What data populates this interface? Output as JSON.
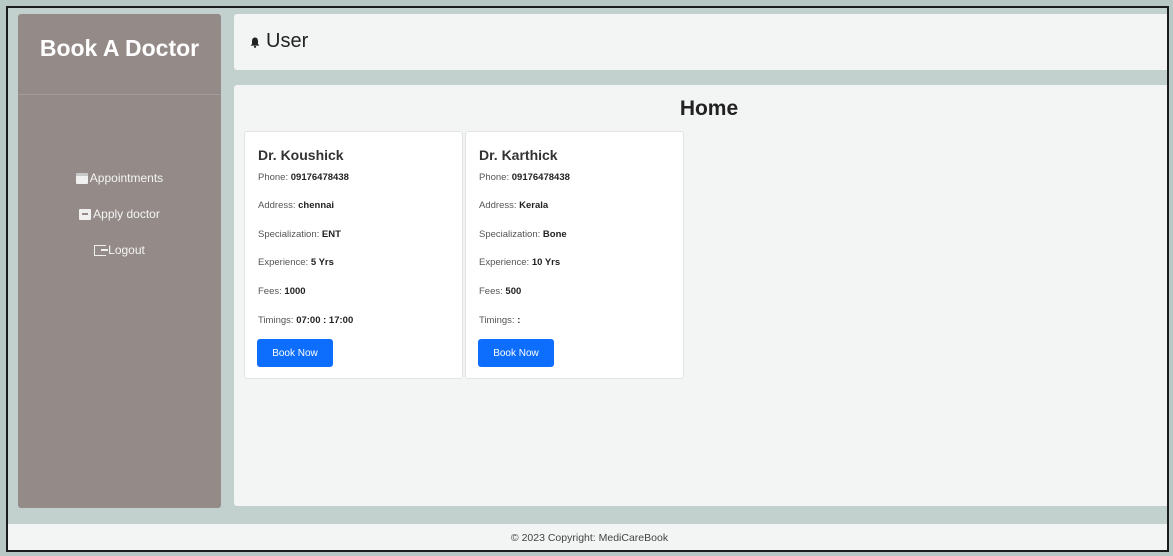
{
  "sidebar": {
    "brand": "Book A Doctor",
    "items": [
      {
        "label": "Appointments",
        "icon": "calendar-icon"
      },
      {
        "label": "Apply doctor",
        "icon": "document-icon"
      },
      {
        "label": "Logout",
        "icon": "logout-icon"
      }
    ]
  },
  "header": {
    "user_label": "User",
    "icon": "bell-icon"
  },
  "main": {
    "title": "Home",
    "doctors": [
      {
        "name": "Dr. Koushick",
        "phone_label": "Phone:",
        "phone": "09176478438",
        "address_label": "Address:",
        "address": "chennai",
        "specialization_label": "Specialization:",
        "specialization": "ENT",
        "experience_label": "Experience:",
        "experience": "5 Yrs",
        "fees_label": "Fees:",
        "fees": "1000",
        "timings_label": "Timings:",
        "timings": "07:00 : 17:00",
        "button": "Book Now"
      },
      {
        "name": "Dr. Karthick",
        "phone_label": "Phone:",
        "phone": "09176478438",
        "address_label": "Address:",
        "address": "Kerala",
        "specialization_label": "Specialization:",
        "specialization": "Bone",
        "experience_label": "Experience:",
        "experience": "10 Yrs",
        "fees_label": "Fees:",
        "fees": "500",
        "timings_label": "Timings:",
        "timings": ":",
        "button": "Book Now"
      }
    ]
  },
  "footer": {
    "text": "© 2023 Copyright: MediCareBook"
  },
  "colors": {
    "sidebar": "#948b89",
    "background": "#c3d1ce",
    "panel": "#f3f4f4",
    "primary_button": "#0d6efd"
  }
}
